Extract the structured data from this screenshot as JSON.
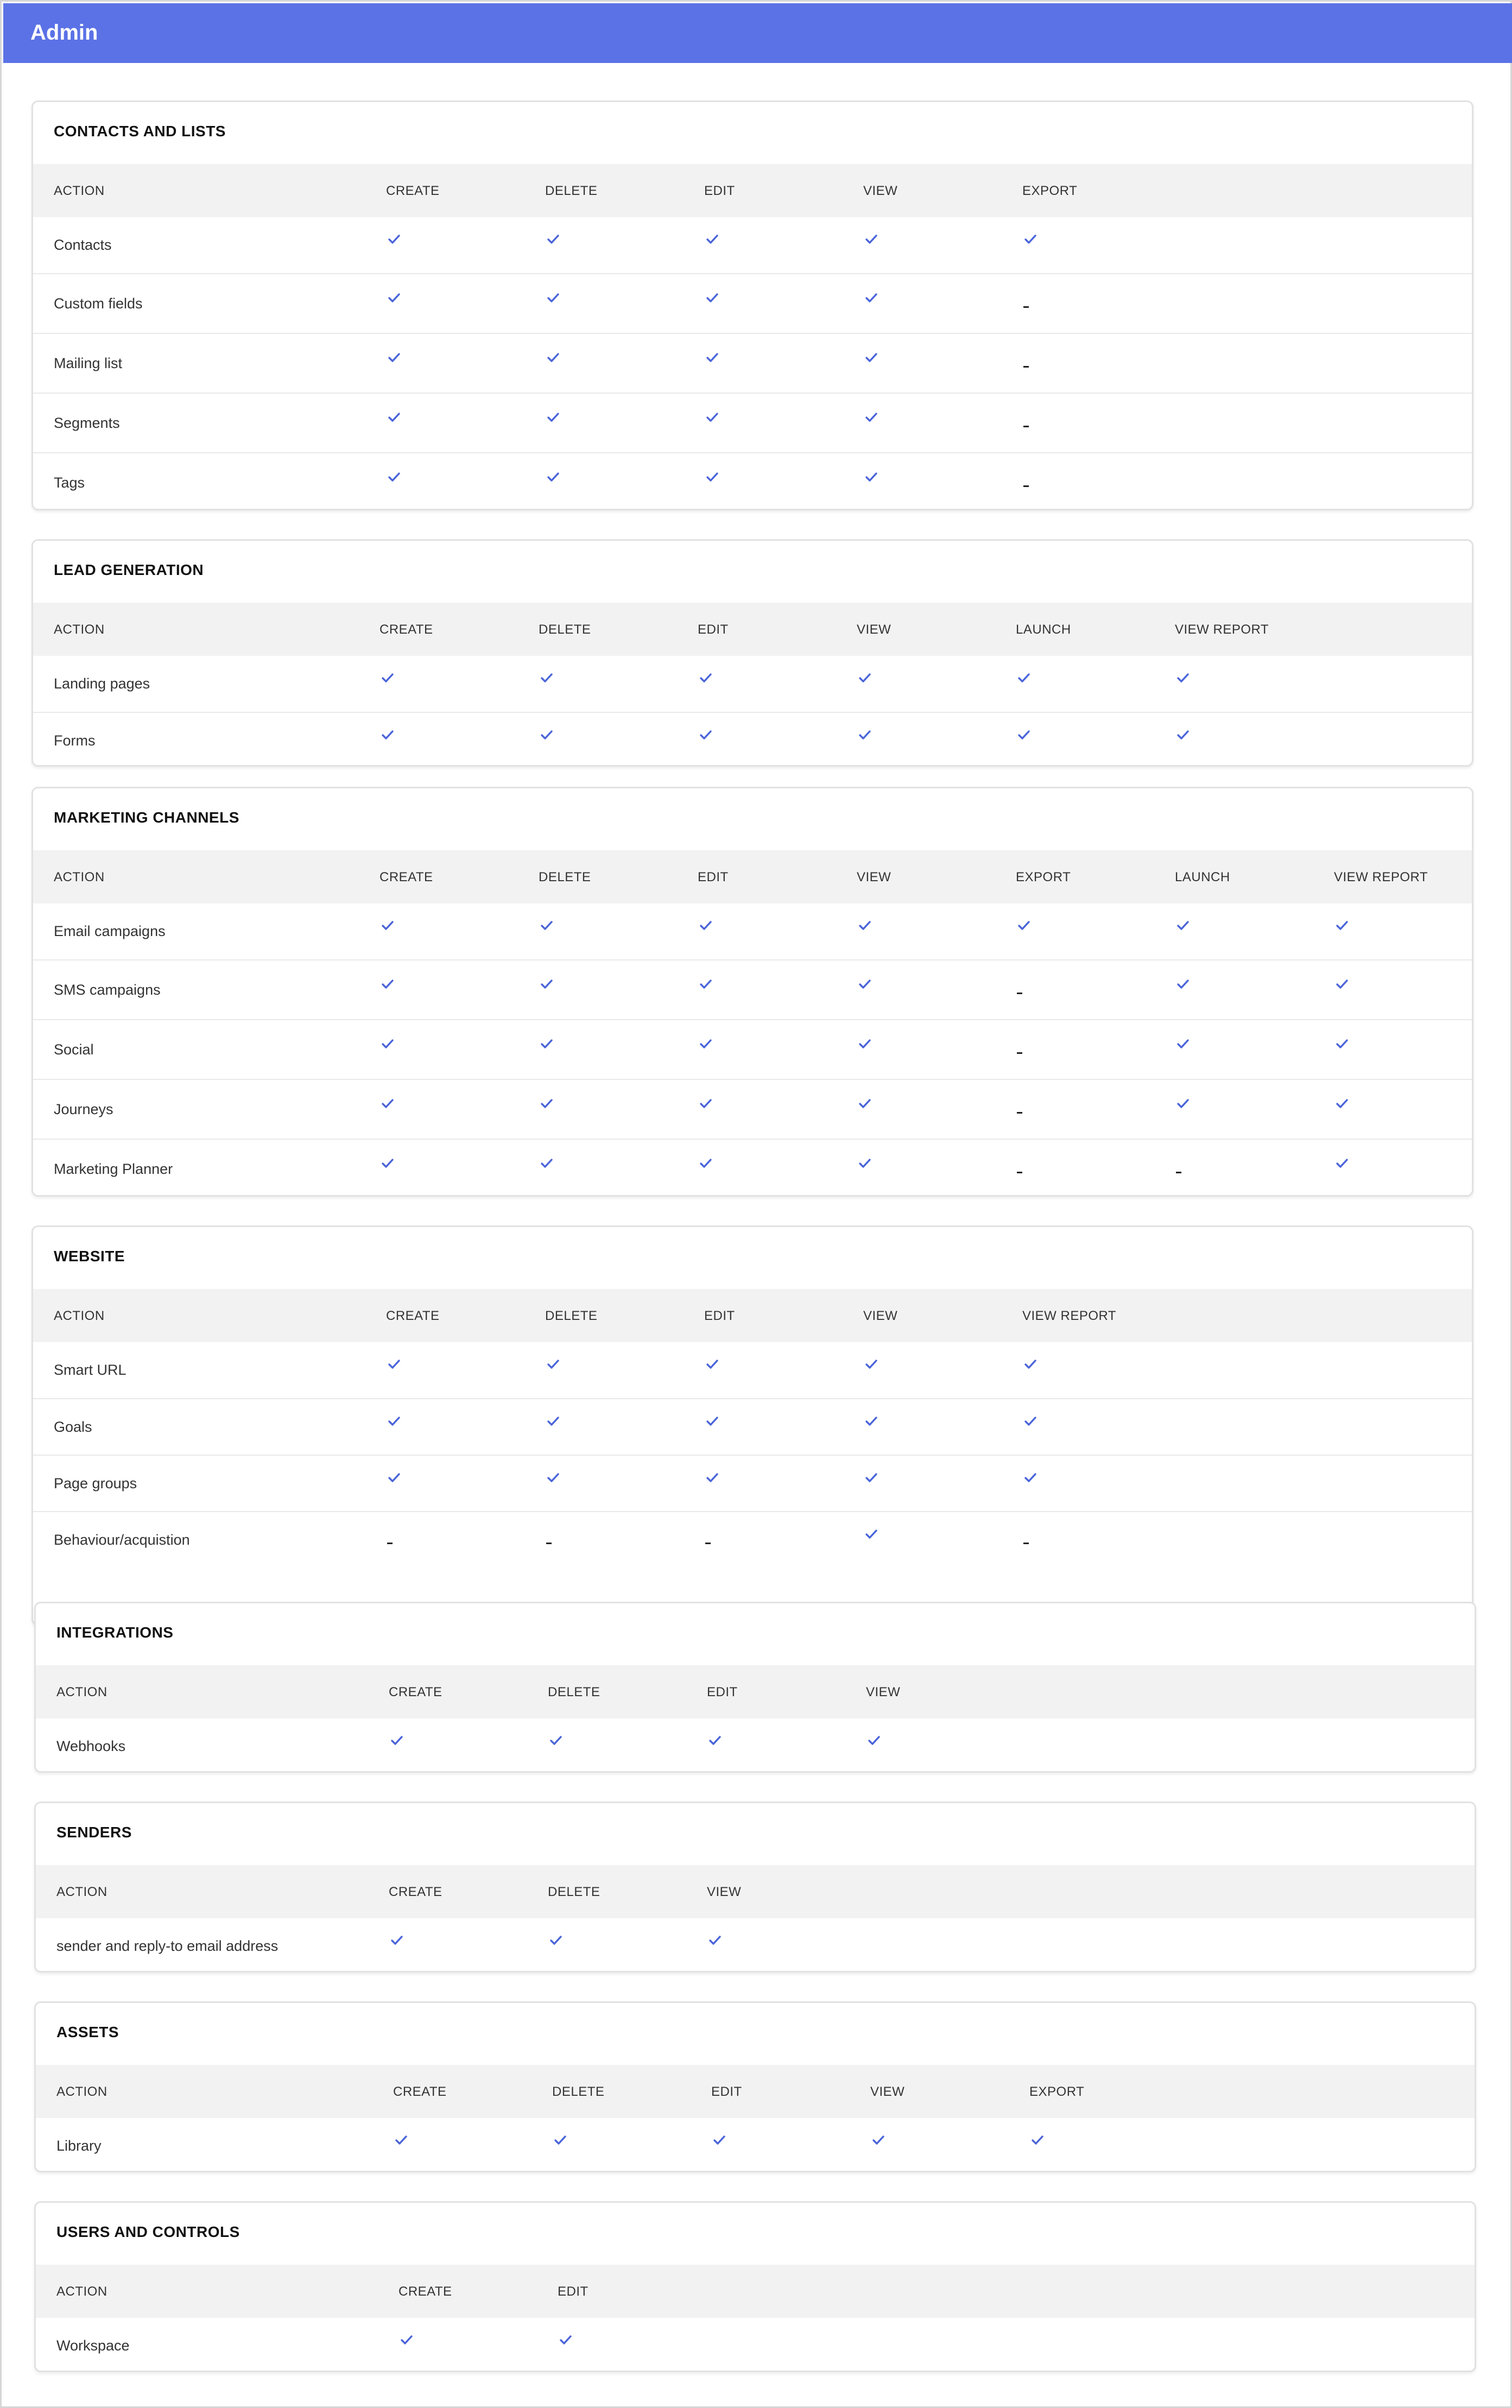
{
  "app": {
    "title": "Admin"
  },
  "accent_color": "#5b72e6",
  "check_color": "#4a64d9",
  "check_icon": "check-icon",
  "sections": [
    {
      "title": "CONTACTS AND LISTS",
      "columns": [
        "ACTION",
        "CREATE",
        "DELETE",
        "EDIT",
        "VIEW",
        "EXPORT"
      ],
      "rows": [
        {
          "label": "Contacts",
          "values": [
            "check",
            "check",
            "check",
            "check",
            "check"
          ]
        },
        {
          "label": "Custom fields",
          "values": [
            "check",
            "check",
            "check",
            "check",
            "-"
          ]
        },
        {
          "label": "Mailing list",
          "values": [
            "check",
            "check",
            "check",
            "check",
            "-"
          ]
        },
        {
          "label": "Segments",
          "values": [
            "check",
            "check",
            "check",
            "check",
            "-"
          ]
        },
        {
          "label": "Tags",
          "values": [
            "check",
            "check",
            "check",
            "check",
            "-"
          ]
        }
      ]
    },
    {
      "title": "LEAD GENERATION",
      "columns": [
        "ACTION",
        "CREATE",
        "DELETE",
        "EDIT",
        "VIEW",
        "LAUNCH",
        "VIEW REPORT"
      ],
      "rows": [
        {
          "label": "Landing pages",
          "values": [
            "check",
            "check",
            "check",
            "check",
            "check",
            "check"
          ]
        },
        {
          "label": "Forms",
          "values": [
            "check",
            "check",
            "check",
            "check",
            "check",
            "check"
          ]
        }
      ]
    },
    {
      "title": "MARKETING CHANNELS",
      "columns": [
        "ACTION",
        "CREATE",
        "DELETE",
        "EDIT",
        "VIEW",
        "EXPORT",
        "LAUNCH",
        "VIEW REPORT"
      ],
      "rows": [
        {
          "label": "Email campaigns",
          "values": [
            "check",
            "check",
            "check",
            "check",
            "check",
            "check",
            "check"
          ]
        },
        {
          "label": "SMS campaigns",
          "values": [
            "check",
            "check",
            "check",
            "check",
            "-",
            "check",
            "check"
          ]
        },
        {
          "label": "Social",
          "values": [
            "check",
            "check",
            "check",
            "check",
            "-",
            "check",
            "check"
          ]
        },
        {
          "label": "Journeys",
          "values": [
            "check",
            "check",
            "check",
            "check",
            "-",
            "check",
            "check"
          ]
        },
        {
          "label": "Marketing Planner",
          "values": [
            "check",
            "check",
            "check",
            "check",
            "-",
            "-",
            "check"
          ]
        }
      ]
    },
    {
      "title": "WEBSITE",
      "columns": [
        "ACTION",
        "CREATE",
        "DELETE",
        "EDIT",
        "VIEW",
        "VIEW REPORT"
      ],
      "rows": [
        {
          "label": "Smart URL",
          "values": [
            "check",
            "check",
            "check",
            "check",
            "check"
          ]
        },
        {
          "label": "Goals",
          "values": [
            "check",
            "check",
            "check",
            "check",
            "check"
          ]
        },
        {
          "label": "Page groups",
          "values": [
            "check",
            "check",
            "check",
            "check",
            "check"
          ]
        },
        {
          "label": "Behaviour/acquistion",
          "values": [
            "-",
            "-",
            "-",
            "check",
            "-"
          ]
        }
      ]
    },
    {
      "title": "INTEGRATIONS",
      "columns": [
        "ACTION",
        "CREATE",
        "DELETE",
        "EDIT",
        "VIEW"
      ],
      "rows": [
        {
          "label": "Webhooks",
          "values": [
            "check",
            "check",
            "check",
            "check"
          ]
        }
      ]
    },
    {
      "title": "SENDERS",
      "columns": [
        "ACTION",
        "CREATE",
        "DELETE",
        "VIEW"
      ],
      "rows": [
        {
          "label": "sender and reply-to email address",
          "values": [
            "check",
            "check",
            "check"
          ]
        }
      ]
    },
    {
      "title": "ASSETS",
      "columns": [
        "ACTION",
        "CREATE",
        "DELETE",
        "EDIT",
        "VIEW",
        "EXPORT"
      ],
      "rows": [
        {
          "label": "Library",
          "values": [
            "check",
            "check",
            "check",
            "check",
            "check"
          ]
        }
      ]
    },
    {
      "title": "USERS AND CONTROLS",
      "columns": [
        "ACTION",
        "CREATE",
        "EDIT"
      ],
      "rows": [
        {
          "label": "Workspace",
          "values": [
            "check",
            "check"
          ]
        }
      ]
    }
  ]
}
